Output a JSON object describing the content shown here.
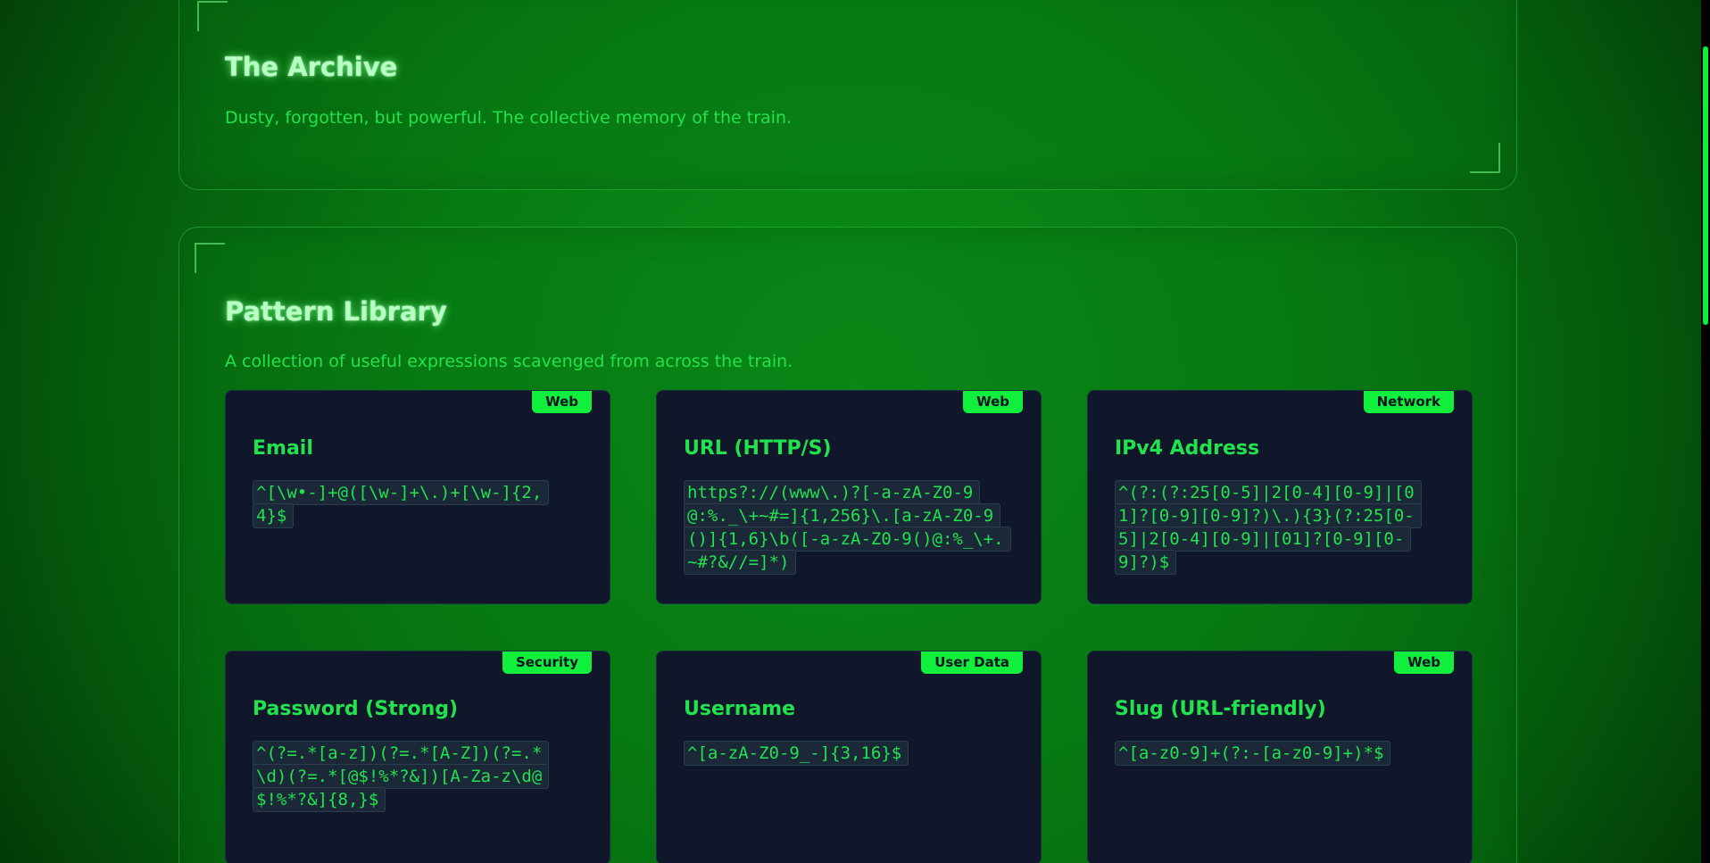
{
  "archive": {
    "title": "The Archive",
    "description": "Dusty, forgotten, but powerful. The collective memory of the train."
  },
  "library": {
    "title": "Pattern Library",
    "description": "A collection of useful expressions scavenged from across the train.",
    "patterns": [
      {
        "tag": "Web",
        "name": "Email",
        "regex": "^[\\w•-]+@([\\w-]+\\.)+[\\w-]{2,4}$"
      },
      {
        "tag": "Web",
        "name": "URL (HTTP/S)",
        "regex": "https?://(www\\.)?[-a-zA-Z0-9@:%._\\+~#=]{1,256}\\.[a-zA-Z0-9()]{1,6}\\b([-a-zA-Z0-9()@:%_\\+.~#?&//=]*)"
      },
      {
        "tag": "Network",
        "name": "IPv4 Address",
        "regex": "^(?:(?:25[0-5]|2[0-4][0-9]|[01]?[0-9][0-9]?)\\.){3}(?:25[0-5]|2[0-4][0-9]|[01]?[0-9][0-9]?)$"
      },
      {
        "tag": "Security",
        "name": "Password (Strong)",
        "regex": "^(?=.*[a-z])(?=.*[A-Z])(?=.*\\d)(?=.*[@$!%*?&])[A-Za-z\\d@$!%*?&]{8,}$"
      },
      {
        "tag": "User Data",
        "name": "Username",
        "regex": "^[a-zA-Z0-9_-]{3,16}$"
      },
      {
        "tag": "Web",
        "name": "Slug (URL-friendly)",
        "regex": "^[a-z0-9]+(?:-[a-z0-9]+)*$"
      }
    ]
  },
  "colors": {
    "accent": "#10ef3c",
    "text": "#22e24e",
    "card_bg": "#11172a"
  }
}
